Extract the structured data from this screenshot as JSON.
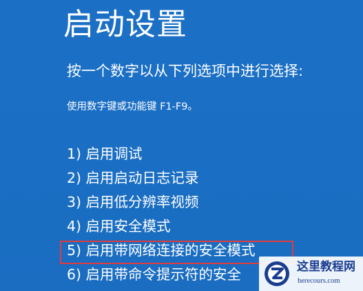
{
  "screen": {
    "title": "启动设置",
    "prompt": "按一个数字以从下列选项中进行选择:",
    "hint": "使用数字键或功能键 F1-F9。",
    "options": [
      {
        "label": "1) 启用调试"
      },
      {
        "label": "2) 启用启动日志记录"
      },
      {
        "label": "3) 启用低分辨率视频"
      },
      {
        "label": "4) 启用安全模式"
      },
      {
        "label": "5) 启用带网络连接的安全模式",
        "highlighted": true
      },
      {
        "label": "6) 启用带命令提示符的安全"
      }
    ]
  },
  "colors": {
    "background": "#1a6fc4",
    "text": "#ffffff",
    "highlight_border": "#e23b3b"
  },
  "watermark": {
    "name": "这里教程网",
    "url": "herecours.com",
    "logo_icon": "z-logo-icon"
  }
}
